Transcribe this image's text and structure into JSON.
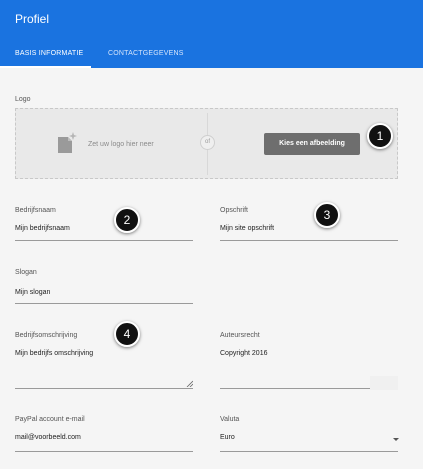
{
  "header": {
    "title": "Profiel",
    "tabs": [
      {
        "label": "BASIS INFORMATIE",
        "active": true
      },
      {
        "label": "CONTACTGEGEVENS",
        "active": false
      }
    ],
    "color": "#1a73e0"
  },
  "logo": {
    "label": "Logo",
    "drop_text": "Zet uw logo hier neer",
    "or_text": "of",
    "button_label": "Kies een afbeelding",
    "icon": "image-icon"
  },
  "fields": {
    "company_name": {
      "label": "Bedrijfsnaam",
      "value": "Mijn bedrijfsnaam"
    },
    "caption": {
      "label": "Opschrift",
      "value": "Mijn site opschrift"
    },
    "slogan": {
      "label": "Slogan",
      "value": "Mijn slogan"
    },
    "description": {
      "label": "Bedrijfsomschrijving",
      "value": "Mijn bedrijfs omschrijving"
    },
    "copyright": {
      "label": "Auteursrecht",
      "value": "Copyright 2016"
    },
    "paypal": {
      "label": "PayPal account e-mail",
      "value": "mail@voorbeeld.com"
    },
    "currency": {
      "label": "Valuta",
      "value": "Euro"
    }
  },
  "badges": [
    "1",
    "2",
    "3",
    "4"
  ]
}
